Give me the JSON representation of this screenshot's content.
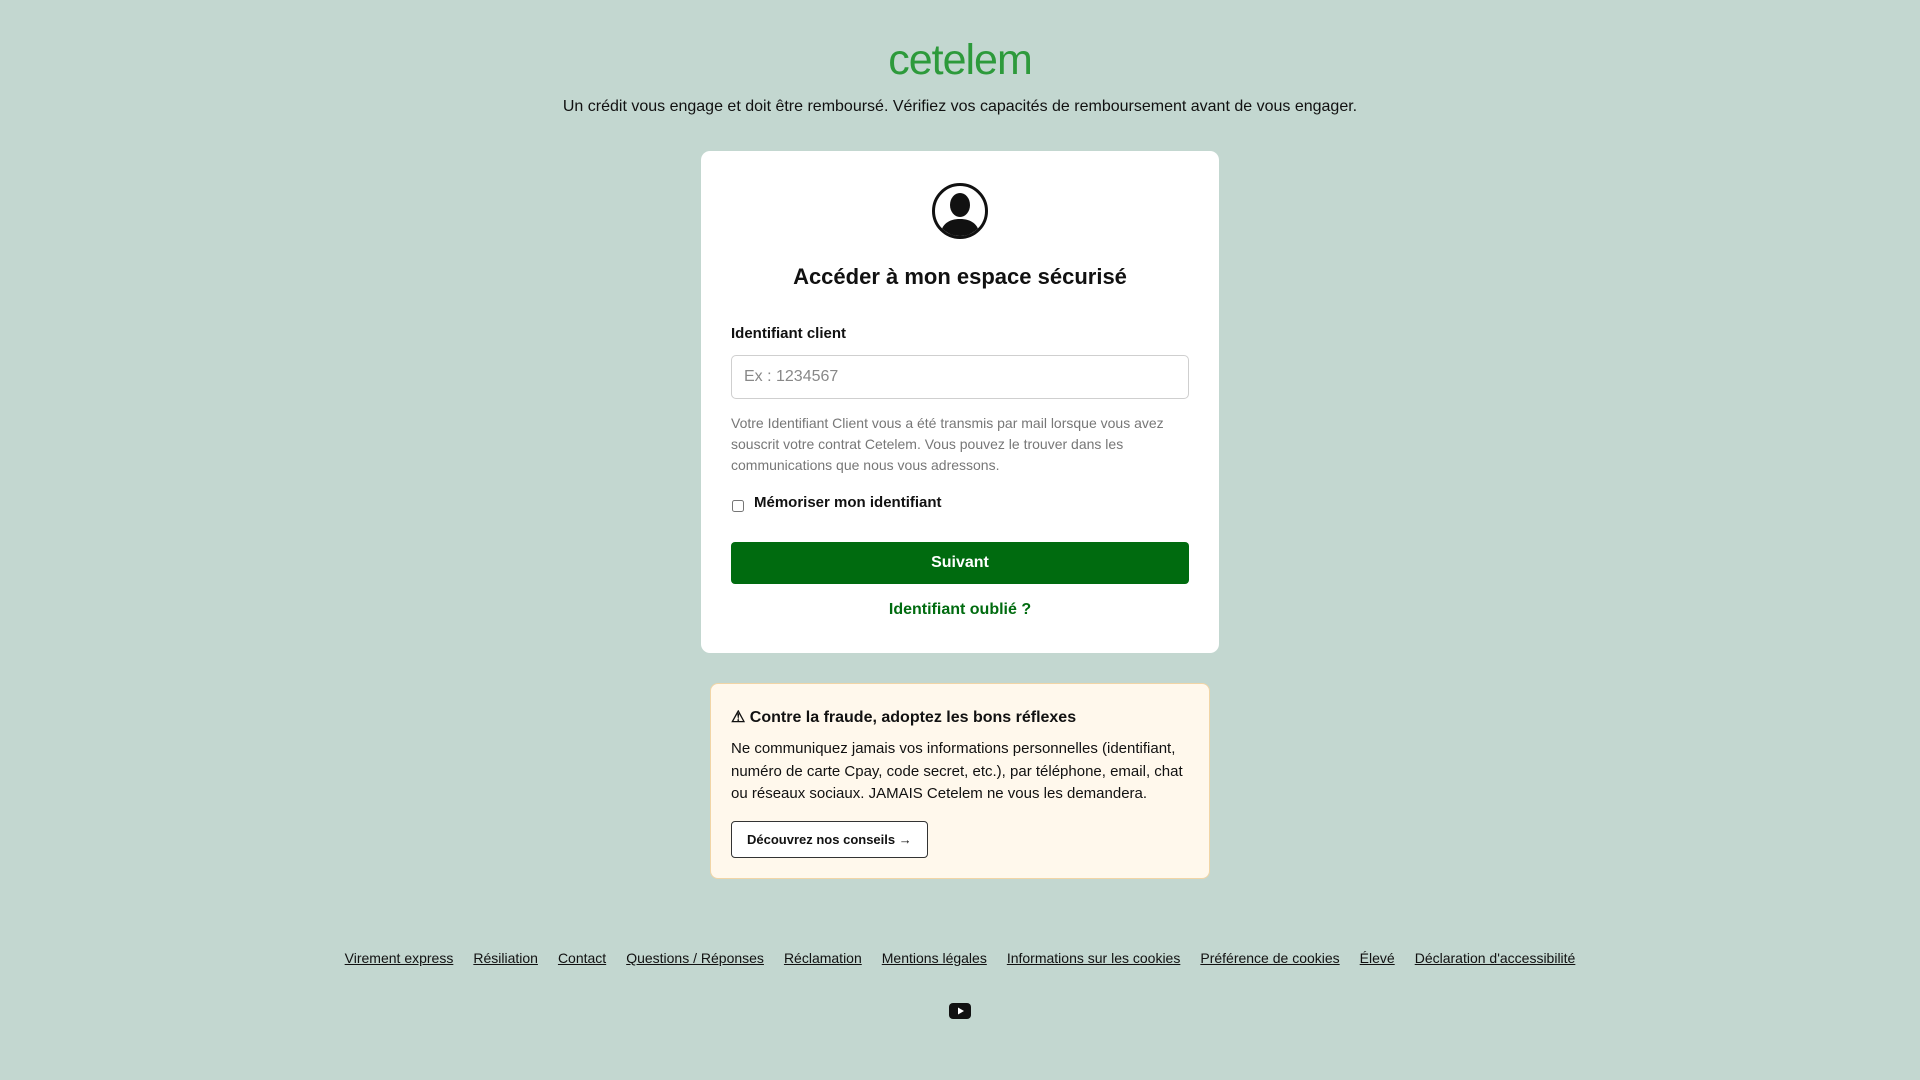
{
  "header": {
    "logo_text": "cetelem",
    "disclaimer": "Un crédit vous engage et doit être remboursé. Vérifiez vos capacités de remboursement avant de vous engager."
  },
  "login": {
    "avatar_icon": "user-avatar-icon",
    "title": "Accéder à mon espace sécurisé",
    "id_label": "Identifiant client",
    "id_placeholder": "Ex : 1234567",
    "id_value": "",
    "help_text": "Votre Identifiant Client vous a été transmis par mail lorsque vous avez souscrit votre contrat Cetelem. Vous pouvez le trouver dans les communications que nous vous adressons.",
    "remember_label": "Mémoriser mon identifiant",
    "remember_checked": false,
    "next_button": "Suivant",
    "forgot_link": "Identifiant oublié ?"
  },
  "fraud": {
    "title": "⚠ Contre la fraude, adoptez les bons réflexes",
    "text": "Ne communiquez jamais vos informations personnelles (identifiant, numéro de carte Cpay, code secret, etc.), par téléphone, email, chat ou réseaux sociaux. JAMAIS Cetelem ne vous les demandera.",
    "button": "Découvrez nos conseils →"
  },
  "footer": {
    "links": [
      "Virement express",
      "Résiliation",
      "Contact",
      "Questions / Réponses",
      "Réclamation",
      "Mentions légales",
      "Informations sur les cookies",
      "Préférence de cookies",
      "Élevé",
      "Déclaration d'accessibilité"
    ],
    "social_icon": "youtube-icon"
  },
  "colors": {
    "background": "#c3d7d0",
    "brand_green": "#2d9a3b",
    "button_green": "#006b0f",
    "warning_bg": "#fff8ec"
  }
}
